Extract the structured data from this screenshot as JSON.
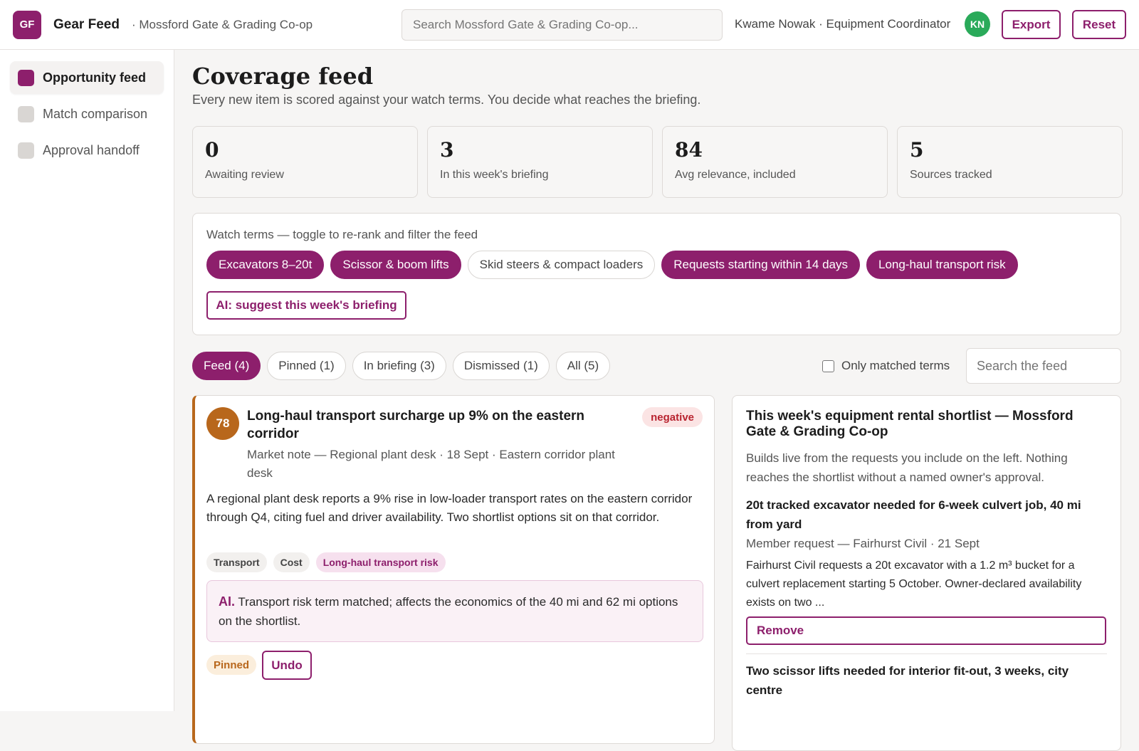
{
  "header": {
    "logo": "GF",
    "app_title": "Gear Feed",
    "org": "· Mossford Gate & Grading Co-op",
    "search_placeholder": "Search Mossford Gate & Grading Co-op...",
    "user": "Kwame Nowak · Equipment Coordinator",
    "avatar": "KN",
    "export_label": "Export",
    "reset_label": "Reset"
  },
  "sidebar": {
    "items": [
      {
        "label": "Opportunity feed",
        "active": true
      },
      {
        "label": "Match comparison",
        "active": false
      },
      {
        "label": "Approval handoff",
        "active": false
      }
    ]
  },
  "main": {
    "title": "Coverage feed",
    "subtitle": "Every new item is scored against your watch terms. You decide what reaches the briefing.",
    "stats": [
      {
        "value": "0",
        "label": "Awaiting review"
      },
      {
        "value": "3",
        "label": "In this week's briefing"
      },
      {
        "value": "84",
        "label": "Avg relevance, included"
      },
      {
        "value": "5",
        "label": "Sources tracked"
      }
    ],
    "watch": {
      "label": "Watch terms — toggle to re-rank and filter the feed",
      "terms": [
        {
          "label": "Excavators 8–20t",
          "on": true
        },
        {
          "label": "Scissor & boom lifts",
          "on": true
        },
        {
          "label": "Skid steers & compact loaders",
          "on": false
        },
        {
          "label": "Requests starting within 14 days",
          "on": true
        },
        {
          "label": "Long-haul transport risk",
          "on": true
        }
      ],
      "ai_suggest_label": "AI: suggest this week's briefing"
    },
    "tabs": [
      {
        "label": "Feed (4)",
        "active": true
      },
      {
        "label": "Pinned (1)",
        "active": false
      },
      {
        "label": "In briefing (3)",
        "active": false
      },
      {
        "label": "Dismissed (1)",
        "active": false
      },
      {
        "label": "All (5)",
        "active": false
      }
    ],
    "only_matched_label": "Only matched terms",
    "feed_search_placeholder": "Search the feed"
  },
  "feed_card": {
    "score": "78",
    "title": "Long-haul transport surcharge up 9% on the eastern corridor",
    "sentiment": "negative",
    "meta": "Market note — Regional plant desk · 18 Sept · Eastern corridor plant desk",
    "body": "A regional plant desk reports a 9% rise in low-loader transport rates on the eastern corridor through Q4, citing fuel and driver availability. Two shortlist options sit on that corridor.",
    "tags": [
      {
        "label": "Transport",
        "highlight": false
      },
      {
        "label": "Cost",
        "highlight": false
      },
      {
        "label": "Long-haul transport risk",
        "highlight": true
      }
    ],
    "ai_prefix": "AI.",
    "ai_text": " Transport risk term matched; affects the economics of the 40 mi and 62 mi options on the shortlist.",
    "pinned_label": "Pinned",
    "undo_label": "Undo"
  },
  "shortlist": {
    "title": "This week's equipment rental shortlist — Mossford Gate & Grading Co-op",
    "subtitle": "Builds live from the requests you include on the left. Nothing reaches the shortlist without a named owner's approval.",
    "item1": {
      "title": "20t tracked excavator needed for 6-week culvert job, 40 mi from yard",
      "meta": "Member request — Fairhurst Civil · 21 Sept",
      "body": "Fairhurst Civil requests a 20t excavator with a 1.2 m³ bucket for a culvert replacement starting 5 October. Owner-declared availability exists on two ...",
      "remove_label": "Remove"
    },
    "item2": {
      "title": "Two scissor lifts needed for interior fit-out, 3 weeks, city centre"
    }
  },
  "colors": {
    "brand": "#8d1f6c",
    "score": "#b8671c",
    "avatar": "#2aaa5a"
  }
}
